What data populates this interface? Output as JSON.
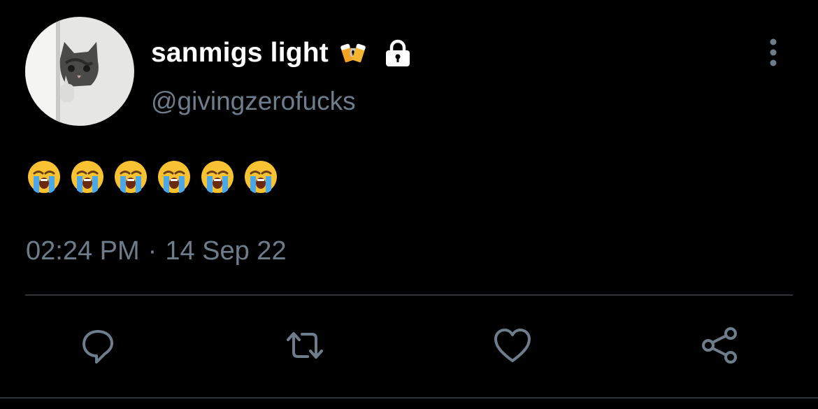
{
  "tweet": {
    "display_name": "sanmigs light",
    "name_emoji": "beer-mugs-emoji",
    "locked_icon": "lock-icon",
    "handle": "@givingzerofucks",
    "text_emojis": [
      "loudly-crying-face-emoji",
      "loudly-crying-face-emoji",
      "loudly-crying-face-emoji",
      "loudly-crying-face-emoji",
      "loudly-crying-face-emoji",
      "loudly-crying-face-emoji"
    ],
    "time": "02:24 PM",
    "separator": "·",
    "date": "14 Sep 22"
  },
  "actions": [
    {
      "icon": "reply-icon"
    },
    {
      "icon": "retweet-icon"
    },
    {
      "icon": "like-icon"
    },
    {
      "icon": "share-icon"
    }
  ],
  "colors": {
    "background": "#000000",
    "primary_text": "#ffffff",
    "secondary_text": "#6e7d8c",
    "divider": "#2f3336"
  }
}
